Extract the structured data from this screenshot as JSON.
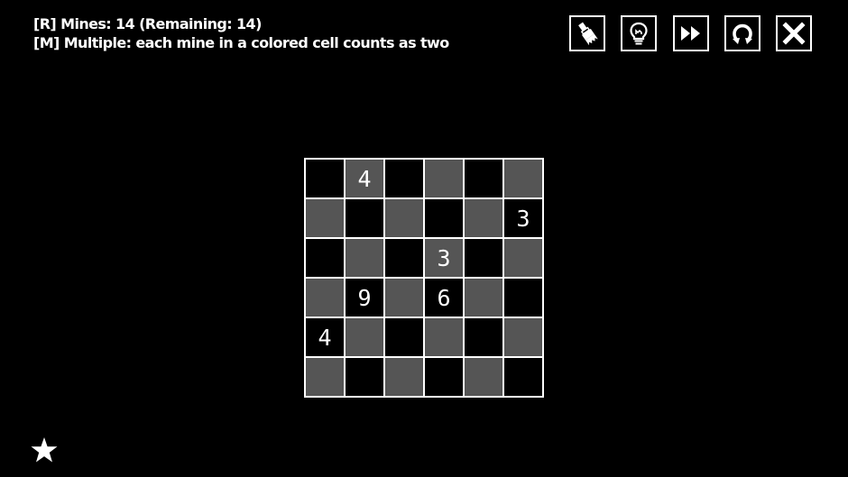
{
  "rules": {
    "line1": "[R] Mines: 14 (Remaining: 14)",
    "line2": "[M] Multiple: each mine in a colored cell counts as two"
  },
  "toolbar": [
    {
      "name": "brush-button",
      "icon": "brush-icon"
    },
    {
      "name": "hint-button",
      "icon": "lightbulb-icon"
    },
    {
      "name": "skip-button",
      "icon": "fast-forward-icon"
    },
    {
      "name": "restart-button",
      "icon": "restart-icon"
    },
    {
      "name": "close-button",
      "icon": "close-icon"
    }
  ],
  "board": {
    "rows": 6,
    "cols": 6,
    "cells": [
      [
        "",
        "4",
        "",
        "",
        "",
        ""
      ],
      [
        "",
        "",
        "",
        "",
        "",
        "3"
      ],
      [
        "",
        "",
        "",
        "3",
        "",
        ""
      ],
      [
        "",
        "9",
        "",
        "6",
        "",
        ""
      ],
      [
        "4",
        "",
        "",
        "",
        "",
        ""
      ],
      [
        "",
        "",
        "",
        "",
        "",
        ""
      ]
    ],
    "colors": {
      "light": "#555555",
      "dark": "#000000",
      "grid": "#ffffff"
    }
  },
  "footer": {
    "icon": "star-icon"
  }
}
